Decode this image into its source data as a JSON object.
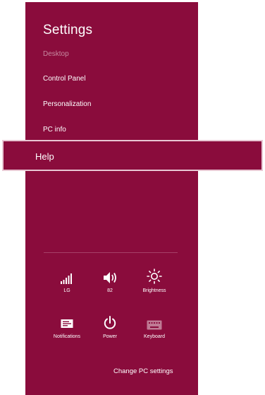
{
  "panel": {
    "title": "Settings",
    "items": [
      {
        "label": "Desktop",
        "enabled": false
      },
      {
        "label": "Control Panel",
        "enabled": true
      },
      {
        "label": "Personalization",
        "enabled": true
      },
      {
        "label": "PC info",
        "enabled": true
      }
    ],
    "highlighted_item": {
      "label": "Help"
    },
    "quick_settings": [
      {
        "label": "LG",
        "icon": "network-signal-icon"
      },
      {
        "label": "82",
        "icon": "volume-icon"
      },
      {
        "label": "Brightness",
        "icon": "brightness-icon"
      },
      {
        "label": "Notifications",
        "icon": "notifications-icon"
      },
      {
        "label": "Power",
        "icon": "power-icon"
      },
      {
        "label": "Keyboard",
        "icon": "keyboard-icon"
      }
    ],
    "change_settings": "Change PC settings"
  },
  "colors": {
    "panel_bg": "#8a0c3c",
    "highlight_border": "#e8c7d3",
    "text": "#ffffff",
    "disabled_text": "#c78aa0"
  }
}
